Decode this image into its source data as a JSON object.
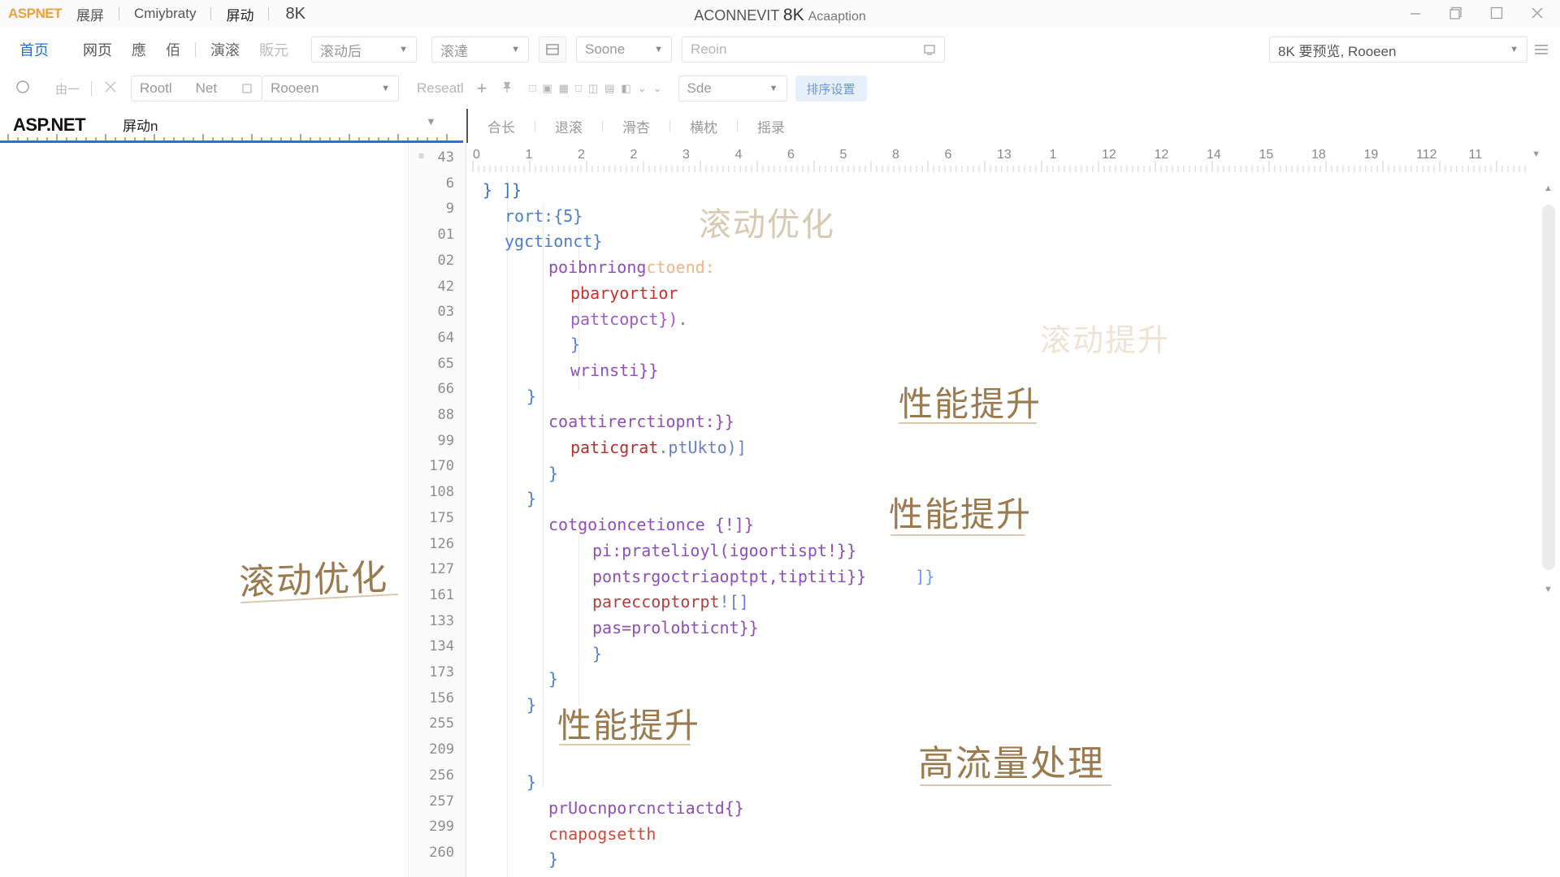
{
  "titlebar": {
    "logo": "ASPNET",
    "items": [
      "展屏",
      "Cmiybraty",
      "屏动"
    ],
    "badge": "8K",
    "title_prefix": "ACONNEVIT",
    "title_8k": "8K",
    "title_suffix": "Acaaption"
  },
  "window_controls": [
    "minimize",
    "restore",
    "maximize",
    "close"
  ],
  "toolbar1": {
    "tab_home": "首页",
    "tabs": [
      "网页",
      "應",
      "佰"
    ],
    "tab_more": [
      "演滚",
      "販元"
    ],
    "dropdown1": "滚动后",
    "dropdown2": "滚達",
    "dropdown3": "Soone",
    "field_placeholder": "Reoin",
    "right_select": "8K 要预览, Rooeen"
  },
  "toolbar2": {
    "undo_label": "由一",
    "root_label": "Rootl",
    "net_label": "Net",
    "dropdown_value": "Rooeen",
    "recent_label": "Reseatl",
    "side_label": "Sde",
    "action_button": "排序设置"
  },
  "left_panel": {
    "title": "ASP.NET",
    "subtitle": "屏动n"
  },
  "right_tabs": [
    "合长",
    "退滚",
    "滑杏",
    "横枕",
    "摇录"
  ],
  "ruler_numbers": [
    "0",
    "1",
    "2",
    "2",
    "3",
    "4",
    "6",
    "5",
    "8",
    "6",
    "13",
    "1",
    "12",
    "12",
    "14",
    "15",
    "18",
    "19",
    "112",
    "11"
  ],
  "line_numbers": [
    "43",
    "6",
    "9",
    "01",
    "02",
    "42",
    "03",
    "64",
    "65",
    "66",
    "88",
    "99",
    "170",
    "108",
    "175",
    "126",
    "127",
    "161",
    "133",
    "134",
    "173",
    "156",
    "255",
    "209",
    "256",
    "257",
    "299",
    "260"
  ],
  "code_lines": [
    {
      "indent": 0,
      "parts": [
        {
          "t": "} ]}",
          "c": "#3b6fc9"
        }
      ]
    },
    {
      "indent": 1,
      "parts": [
        {
          "t": "rort:{5}",
          "c": "#4a7fd0"
        }
      ]
    },
    {
      "indent": 1,
      "parts": [
        {
          "t": "ygctionct}",
          "c": "#4a7fd0"
        }
      ]
    },
    {
      "indent": 3,
      "parts": [
        {
          "t": "poibnriong",
          "c": "#8e4fb8"
        },
        {
          "t": "ctoend:",
          "c": "#f0b48a"
        }
      ]
    },
    {
      "indent": 4,
      "parts": [
        {
          "t": "pbaryortior",
          "c": "#d12c2c"
        }
      ]
    },
    {
      "indent": 4,
      "parts": [
        {
          "t": "pattcopct}).",
          "c": "#a05ac8"
        }
      ]
    },
    {
      "indent": 4,
      "parts": [
        {
          "t": "}",
          "c": "#5a7fd0"
        }
      ]
    },
    {
      "indent": 4,
      "parts": [
        {
          "t": "wrinsti}}",
          "c": "#8e4fb8"
        }
      ]
    },
    {
      "indent": 2,
      "parts": [
        {
          "t": "}",
          "c": "#4a7fd0"
        }
      ]
    },
    {
      "indent": 3,
      "parts": [
        {
          "t": "coattirerctiopnt:}}",
          "c": "#8e4fb8"
        }
      ]
    },
    {
      "indent": 4,
      "parts": [
        {
          "t": "paticgrat",
          "c": "#b03030"
        },
        {
          "t": ".ptUkto)]",
          "c": "#6a7fc8"
        }
      ]
    },
    {
      "indent": 3,
      "parts": [
        {
          "t": "}",
          "c": "#4a7fd0"
        }
      ]
    },
    {
      "indent": 2,
      "parts": [
        {
          "t": "}",
          "c": "#4a7fd0"
        }
      ]
    },
    {
      "indent": 3,
      "parts": [
        {
          "t": "cotgoioncetionce {!]}",
          "c": "#8e4fb8"
        }
      ]
    },
    {
      "indent": 5,
      "parts": [
        {
          "t": "pi:pratelioyl(igoortispt!}}",
          "c": "#8e4fb8"
        }
      ]
    },
    {
      "indent": 5,
      "parts": [
        {
          "t": "pontsrgoctriaoptpt,tiptiti}}",
          "c": "#8e4fb8"
        },
        {
          "t": "     ]}",
          "c": "#6a9ee0"
        }
      ]
    },
    {
      "indent": 5,
      "parts": [
        {
          "t": "pareccoptorpt",
          "c": "#b04040"
        },
        {
          "t": "![]",
          "c": "#6a7fc8"
        }
      ]
    },
    {
      "indent": 5,
      "parts": [
        {
          "t": "pas=prolobticnt}}",
          "c": "#8e4fb8"
        }
      ]
    },
    {
      "indent": 5,
      "parts": [
        {
          "t": "}",
          "c": "#5a7fd0"
        }
      ]
    },
    {
      "indent": 3,
      "parts": [
        {
          "t": "}",
          "c": "#4a7fd0"
        }
      ]
    },
    {
      "indent": 2,
      "parts": [
        {
          "t": "}",
          "c": "#4a7fd0"
        }
      ]
    },
    {
      "indent": 0,
      "parts": [
        {
          "t": "",
          "c": "#4a7fd0"
        }
      ]
    },
    {
      "indent": 0,
      "parts": [
        {
          "t": "",
          "c": "#4a7fd0"
        }
      ]
    },
    {
      "indent": 2,
      "parts": [
        {
          "t": "}",
          "c": "#4a7fd0"
        }
      ]
    },
    {
      "indent": 3,
      "parts": [
        {
          "t": "prUocnporcnctiactd{}",
          "c": "#8e4fb8"
        }
      ]
    },
    {
      "indent": 3,
      "parts": [
        {
          "t": "cnapogsetth",
          "c": "#d04a3a"
        }
      ]
    },
    {
      "indent": 3,
      "parts": [
        {
          "t": "}",
          "c": "#4a7fd0"
        }
      ]
    }
  ],
  "annotations": {
    "scroll_opt": "滚动优化",
    "perf_boost": "性能提升",
    "high_traffic": "高流量处理",
    "scroll_boost_faint": "滚动提升"
  },
  "colors": {
    "accent_blue": "#2f6fd6",
    "logo_orange": "#e8a13c",
    "annotation_brown": "#9a7a4e"
  }
}
